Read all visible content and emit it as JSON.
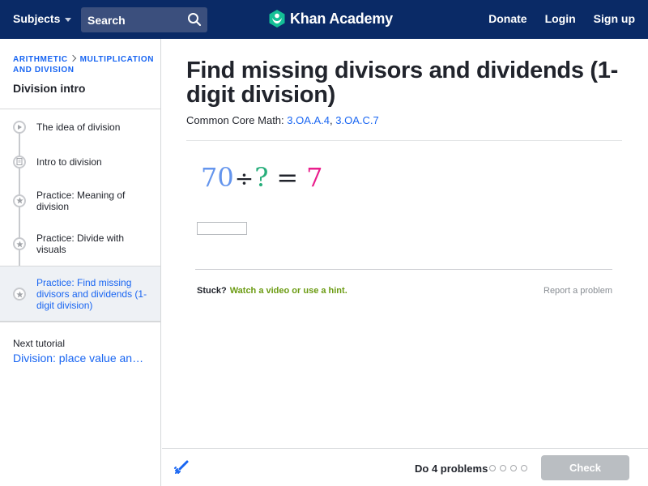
{
  "topbar": {
    "subjects_label": "Subjects",
    "search_placeholder": "Search",
    "brand_name": "Khan Academy",
    "links": [
      "Donate",
      "Login",
      "Sign up"
    ]
  },
  "sidebar": {
    "breadcrumb": [
      "Arithmetic",
      "Multiplication and division"
    ],
    "unit_title": "Division intro",
    "items": [
      {
        "label": "The idea of division",
        "icon": "play-icon"
      },
      {
        "label": "Intro to division",
        "icon": "article-icon"
      },
      {
        "label": "Practice: Meaning of division",
        "icon": "star-icon"
      },
      {
        "label": "Practice: Divide with visuals",
        "icon": "star-icon"
      },
      {
        "label": "Practice: Find missing divisors and dividends (1-digit division)",
        "icon": "star-icon",
        "active": true
      }
    ],
    "next_label": "Next tutorial",
    "next_link": "Division: place value and area"
  },
  "main": {
    "title": "Find missing divisors and dividends (1-digit division)",
    "standards_prefix": "Common Core Math: ",
    "standards": [
      "3.OA.A.4",
      "3.OA.C.7"
    ],
    "equation": {
      "dividend": "70",
      "operator": "÷",
      "unknown": "?",
      "equals": "=",
      "quotient": "7"
    },
    "answer_value": "",
    "stuck_label": "Stuck?",
    "hint_link": "Watch a video or use a hint.",
    "report_link": "Report a problem"
  },
  "footer": {
    "do_label": "Do 4 problems",
    "problems_total": 4,
    "problems_done": 0,
    "check_label": "Check"
  },
  "colors": {
    "nav_bg": "#0a2a66",
    "link": "#1865f2",
    "hint": "#6b9b12",
    "dividend": "#6495ed",
    "unknown": "#28ae7b",
    "quotient": "#e91e8c",
    "check_disabled": "#babec2"
  }
}
